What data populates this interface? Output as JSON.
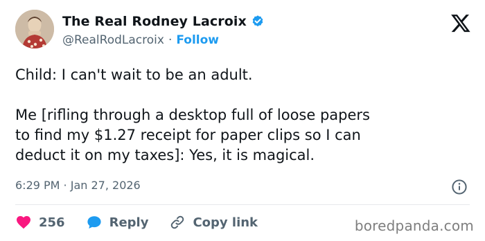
{
  "author": {
    "display_name": "The Real Rodney Lacroix",
    "handle": "@RealRodLacroix",
    "separator": "·",
    "follow_label": "Follow"
  },
  "tweet": {
    "text": "Child: I can't wait to be an adult.\n\nMe [rifling through a desktop full of loose papers\nto find my $1.27 receipt for paper clips so I can\ndeduct it on my taxes]: Yes, it is magical.",
    "timestamp": "6:29 PM · Jan 27, 2026"
  },
  "actions": {
    "likes_count": "256",
    "reply_label": "Reply",
    "copy_link_label": "Copy link"
  },
  "icons": {
    "avatar": "avatar-photo",
    "verified": "verified-badge-icon",
    "platform": "x-logo-icon",
    "info": "info-icon",
    "like": "heart-icon",
    "reply": "speech-bubble-icon",
    "copy_link": "link-icon"
  },
  "colors": {
    "accent": "#1d9bf0",
    "like": "#f91880",
    "text": "#0f1419",
    "muted": "#536471"
  },
  "watermark": "boredpanda.com"
}
